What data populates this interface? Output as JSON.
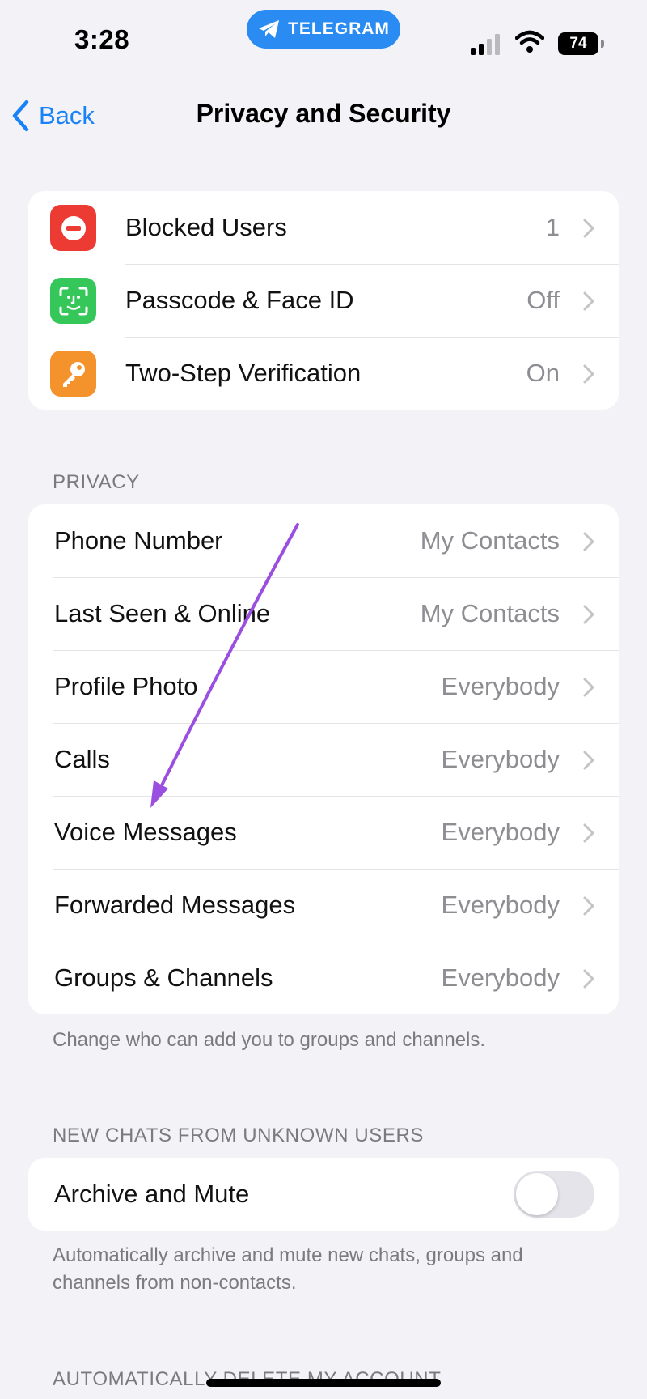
{
  "status_bar": {
    "time": "3:28",
    "app_pill": "TELEGRAM",
    "battery": "74"
  },
  "nav": {
    "back_label": "Back",
    "title": "Privacy and Security"
  },
  "security_group": {
    "items": [
      {
        "label": "Blocked Users",
        "value": "1",
        "icon": "blocked-icon",
        "color": "#ec3b33"
      },
      {
        "label": "Passcode & Face ID",
        "value": "Off",
        "icon": "face-id-icon",
        "color": "#35c759"
      },
      {
        "label": "Two-Step Verification",
        "value": "On",
        "icon": "key-icon",
        "color": "#f4922c"
      }
    ]
  },
  "privacy": {
    "header": "PRIVACY",
    "items": [
      {
        "label": "Phone Number",
        "value": "My Contacts"
      },
      {
        "label": "Last Seen & Online",
        "value": "My Contacts"
      },
      {
        "label": "Profile Photo",
        "value": "Everybody"
      },
      {
        "label": "Calls",
        "value": "Everybody"
      },
      {
        "label": "Voice Messages",
        "value": "Everybody"
      },
      {
        "label": "Forwarded Messages",
        "value": "Everybody"
      },
      {
        "label": "Groups & Channels",
        "value": "Everybody"
      }
    ],
    "footnote": "Change who can add you to groups and channels."
  },
  "new_chats": {
    "header": "NEW CHATS FROM UNKNOWN USERS",
    "label": "Archive and Mute",
    "toggle_on": false,
    "footnote": "Automatically archive and mute new chats, groups and channels from non-contacts."
  },
  "delete_account": {
    "header": "AUTOMATICALLY DELETE MY ACCOUNT"
  },
  "colors": {
    "accent": "#1a82f7",
    "annotation_arrow": "#9b4fe0"
  }
}
